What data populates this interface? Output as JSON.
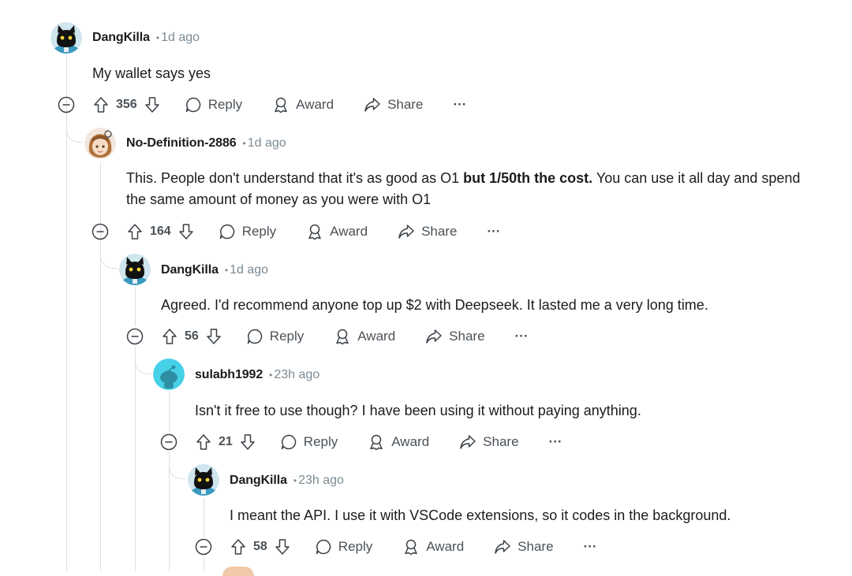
{
  "comments": [
    {
      "username": "DangKilla",
      "time": "1d ago",
      "body": "My wallet says yes",
      "votes": "356",
      "reply": "Reply",
      "award": "Award",
      "share": "Share",
      "more": "···",
      "avatar": "dark-cat-avatar"
    },
    {
      "username": "No-Definition-2886",
      "time": "1d ago",
      "body_pre": "This. People don't understand that it's as good as O1 ",
      "body_bold": "but 1/50th the cost.",
      "body_post": " You can use it all day and spend the same amount of money as you were with O1",
      "votes": "164",
      "reply": "Reply",
      "award": "Award",
      "share": "Share",
      "more": "···",
      "avatar": "anime-girl-avatar"
    },
    {
      "username": "DangKilla",
      "time": "1d ago",
      "body": "Agreed. I'd recommend anyone top up $2 with Deepseek. It lasted me a very long time.",
      "votes": "56",
      "reply": "Reply",
      "award": "Award",
      "share": "Share",
      "more": "···",
      "avatar": "dark-cat-avatar"
    },
    {
      "username": "sulabh1992",
      "time": "23h ago",
      "body": "Isn't it free to use though? I have been using it without paying anything.",
      "votes": "21",
      "reply": "Reply",
      "award": "Award",
      "share": "Share",
      "more": "···",
      "avatar": "snoo-avatar"
    },
    {
      "username": "DangKilla",
      "time": "23h ago",
      "body": "I meant the API. I use it with VSCode extensions, so it codes in the background.",
      "votes": "58",
      "reply": "Reply",
      "award": "Award",
      "share": "Share",
      "more": "···",
      "avatar": "dark-cat-avatar"
    }
  ],
  "colors": {
    "thread_line": "#dcdfe2",
    "text": "#1c1c1c",
    "muted": "#7c8a93",
    "snoo": "#46d1e8"
  }
}
